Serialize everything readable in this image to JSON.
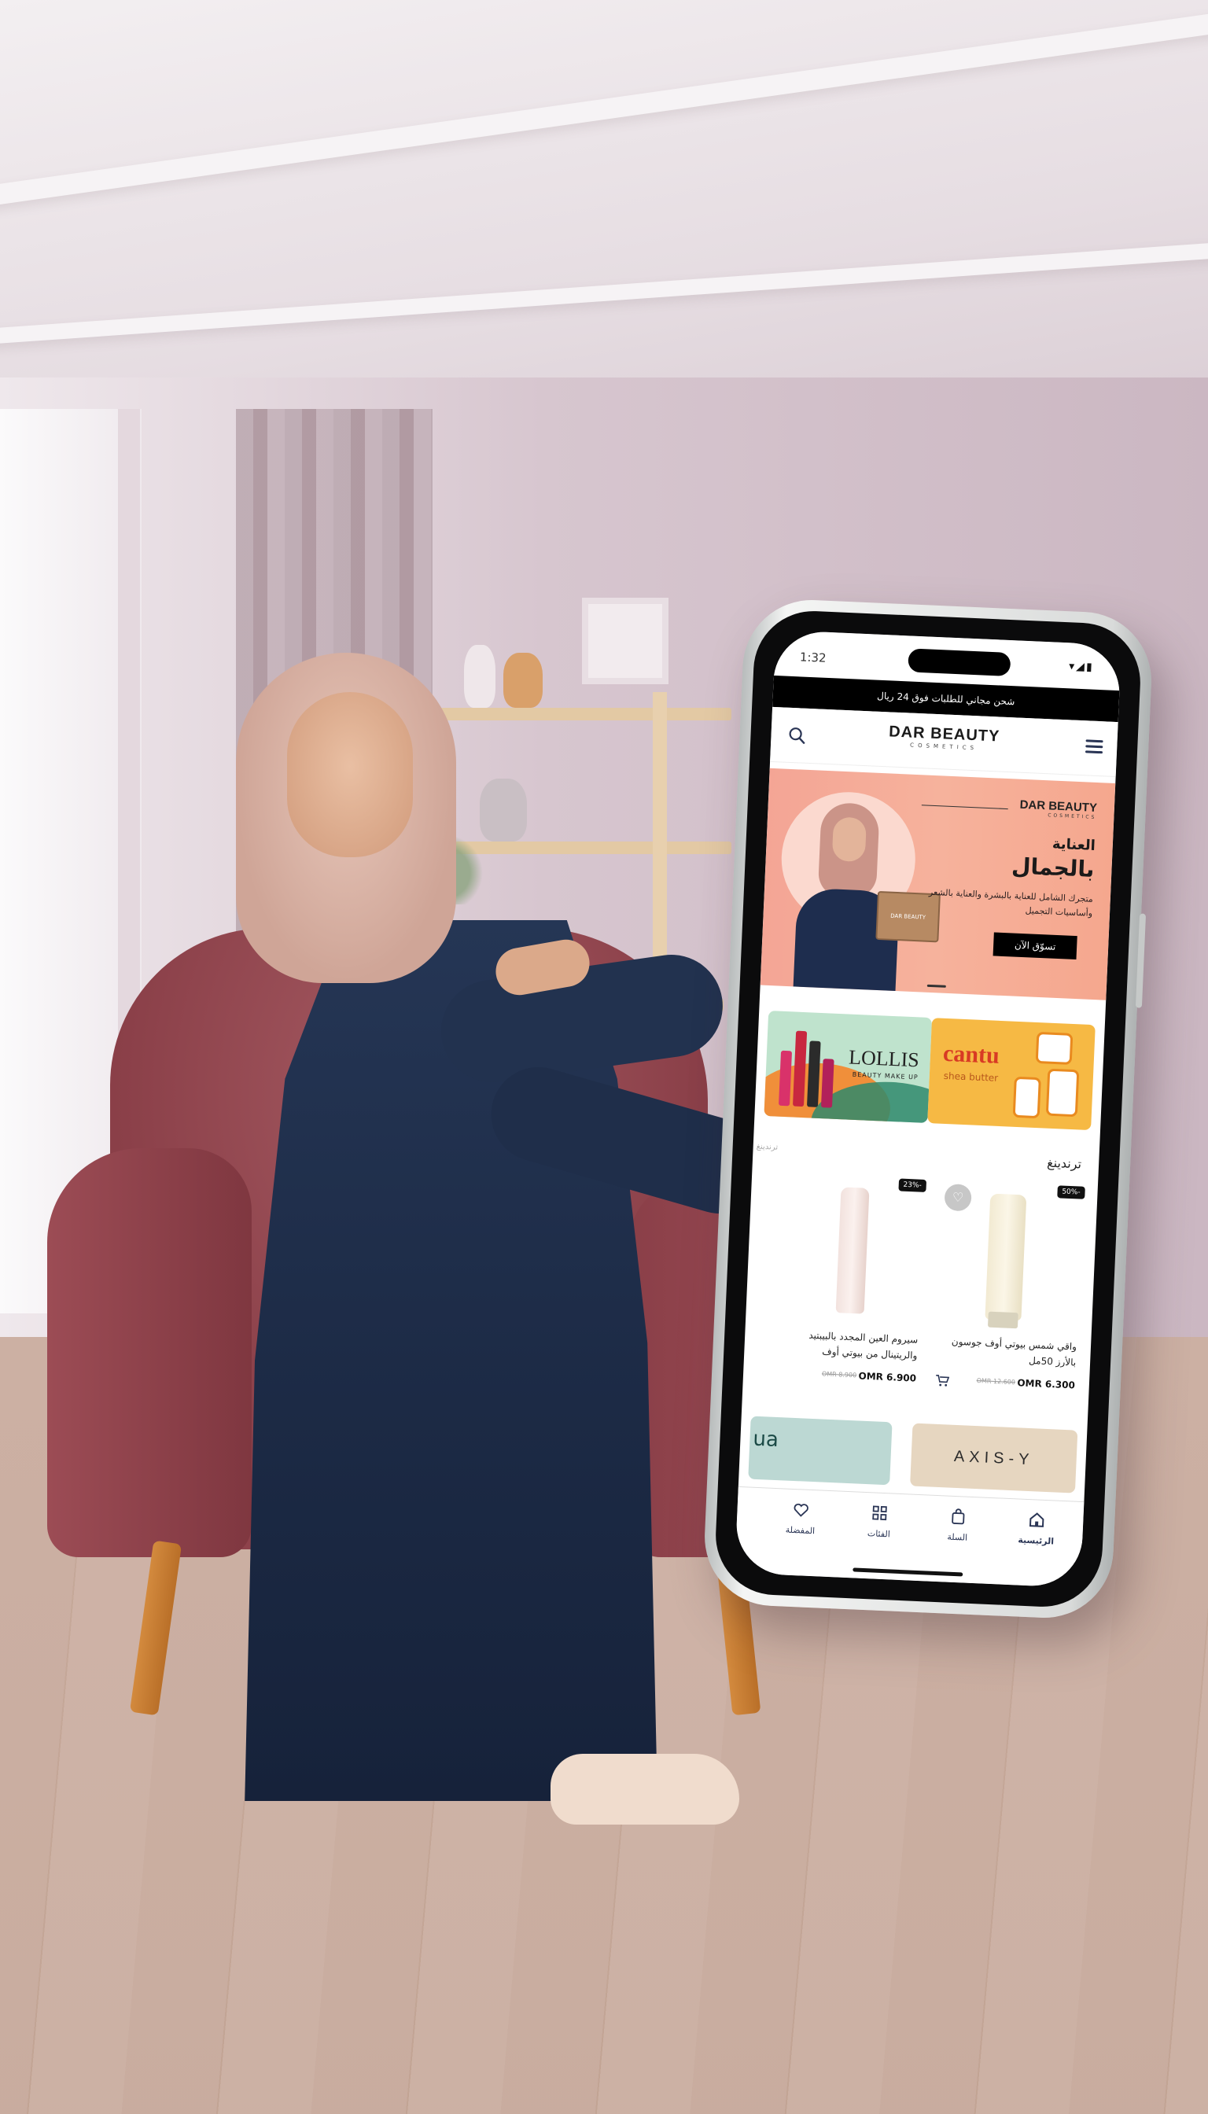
{
  "status_bar": {
    "time": "1:32",
    "icons": "▾◢▮"
  },
  "shipping_banner": {
    "text": "شحن مجاني للطلبات فوق 24 ريال"
  },
  "header": {
    "logo_main": "DAR BEAUTY",
    "logo_sub": "COSMETICS",
    "search_icon": "search-icon",
    "menu_icon": "hamburger-menu-icon"
  },
  "hero": {
    "brand_main": "DAR BEAUTY",
    "brand_sub": "COSMETICS",
    "title_line1": "العناية",
    "title_line2": "بالجمال",
    "description": "متجرك الشامل للعناية بالبشرة والعناية بالشعر وأساسيات التجميل",
    "cta": "تسوّق الآن",
    "box_label": "DAR BEAUTY",
    "background_color": "#f4a595"
  },
  "brands": [
    {
      "name": "LOLLIS",
      "subtitle": "BEAUTY MAKE UP",
      "color": "#bfe3cd"
    },
    {
      "name": "cantu",
      "subtitle": "shea butter",
      "color": "#f6b944"
    }
  ],
  "trending": {
    "title": "ترندينغ",
    "side_label": "ترندينغ"
  },
  "products": [
    {
      "badge": "50%-",
      "name": "واقي شمس بيوتي أوف جوسون بالأرز 50مل",
      "price": "OMR 6.300",
      "old_price": "OMR 12.600",
      "wishlist_icon": "heart-icon",
      "cart_icon": "add-to-cart-icon"
    },
    {
      "badge": "23%-",
      "name": "سيروم العين المجدد بالبيبتيد والريتينال من بيوتي أوف",
      "price": "OMR 6.900",
      "old_price": "OMR 8.900",
      "cart_icon": "add-to-cart-icon"
    }
  ],
  "brand_row2": {
    "axis_label": "AXIS-Y",
    "left_label": "ua"
  },
  "bottom_nav": [
    {
      "label": "الرئيسية",
      "icon": "home-icon",
      "active": true
    },
    {
      "label": "السلة",
      "icon": "bag-icon",
      "active": false
    },
    {
      "label": "الفئات",
      "icon": "grid-icon",
      "active": false
    },
    {
      "label": "المفضلة",
      "icon": "heart-icon",
      "active": false
    }
  ],
  "colors": {
    "brand_navy": "#2a3555",
    "hero_peach": "#f4a595",
    "banner_black": "#000000"
  }
}
